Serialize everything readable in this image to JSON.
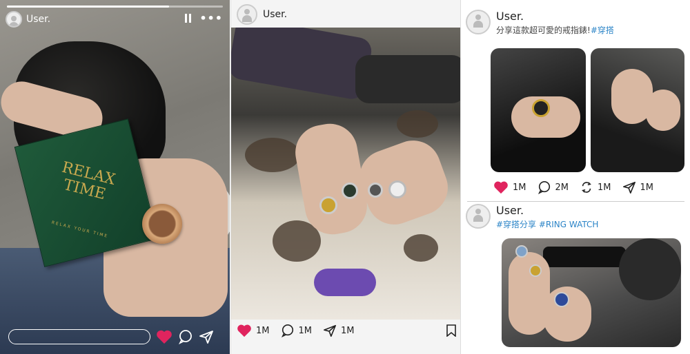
{
  "story": {
    "username": "User.",
    "progress": 0.75,
    "box_title": "RELAX TIME",
    "box_subtitle": "RELAX YOUR TIME",
    "icons": [
      "pause-icon",
      "more-icon",
      "heart-icon",
      "comment-icon",
      "send-icon"
    ],
    "heart_color": "#e0245e"
  },
  "post": {
    "username": "User.",
    "likes": "1M",
    "comments": "1M",
    "shares": "1M",
    "icons": [
      "heart-icon",
      "comment-icon",
      "send-icon",
      "bookmark-icon"
    ],
    "heart_color": "#e0245e"
  },
  "feed": {
    "card1": {
      "username": "User.",
      "caption": "分享這款超可愛的戒指錶!",
      "tag": "#穿搭",
      "likes": "1M",
      "comments": "2M",
      "reposts": "1M",
      "shares": "1M"
    },
    "card2": {
      "username": "User.",
      "tags": "#穿搭分享 #RING WATCH"
    }
  }
}
